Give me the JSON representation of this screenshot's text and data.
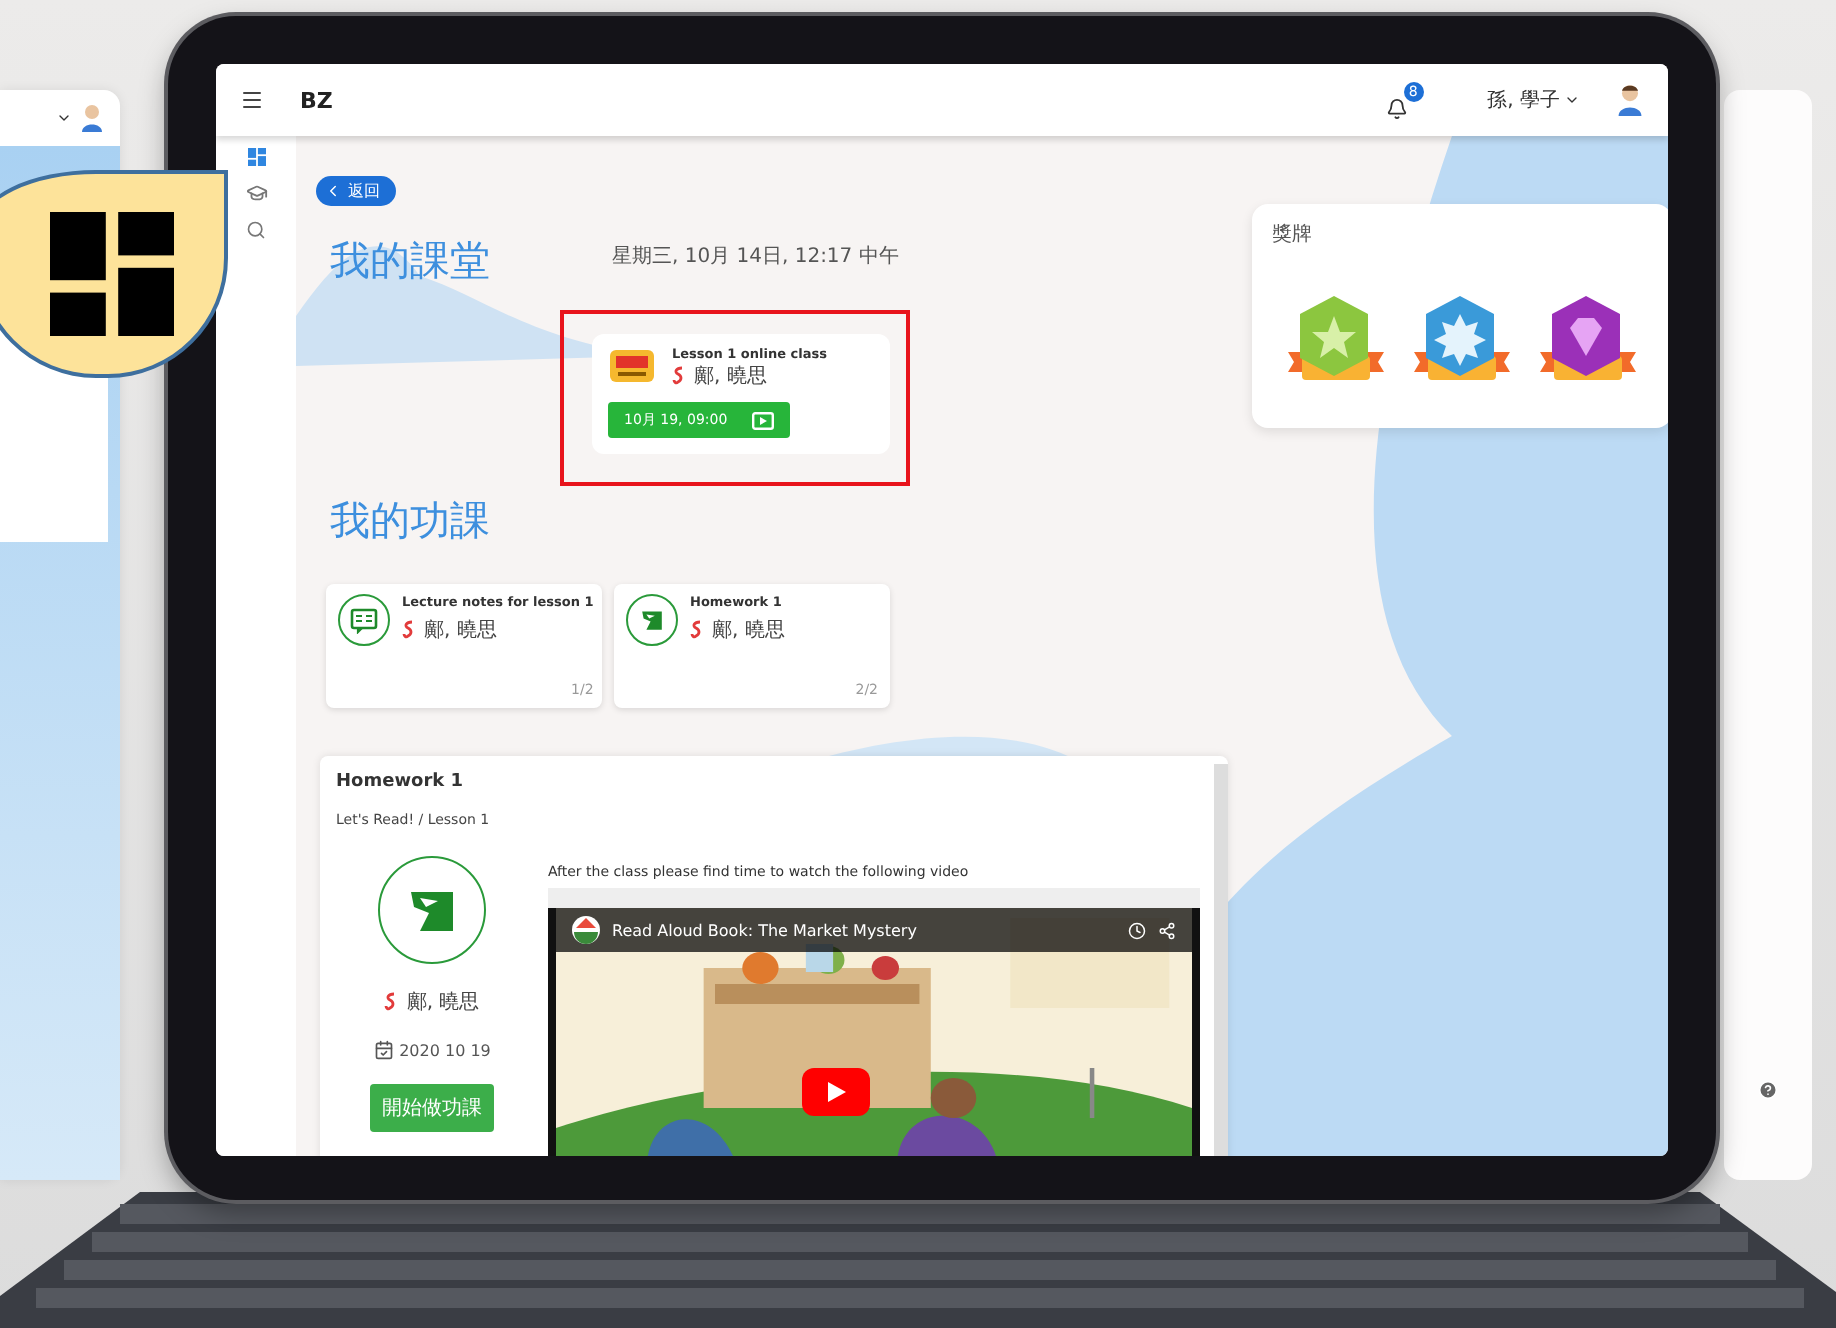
{
  "header": {
    "logo": "BZ",
    "notification_count": "8",
    "user_name": "孫, 學子"
  },
  "rail": [
    {
      "kind": "dashboard",
      "selected": true
    },
    {
      "kind": "courses",
      "selected": false
    },
    {
      "kind": "search",
      "selected": false
    }
  ],
  "back_button": "返回",
  "classes": {
    "title": "我的課堂",
    "date": "星期三, 10月 14日, 12:17 中午",
    "highlighted": true,
    "card": {
      "title": "Lesson 1 online class",
      "teacher": "鄺, 曉思",
      "time": "10月 19, 09:00"
    }
  },
  "homework": {
    "title": "我的功課",
    "cards": [
      {
        "kind": "notes",
        "title": "Lecture notes for lesson 1",
        "teacher": "鄺, 曉思",
        "count": "1/2"
      },
      {
        "kind": "homework",
        "title": "Homework 1",
        "teacher": "鄺, 曉思",
        "count": "2/2"
      }
    ]
  },
  "detail": {
    "title": "Homework 1",
    "breadcrumb": "Let's Read! / Lesson 1",
    "teacher": "鄺, 曉思",
    "date": "2020 10 19",
    "button": "開始做功課",
    "instructions": "After the class please find time to watch the following video",
    "video_title": "Read Aloud Book: The Market Mystery"
  },
  "medals": {
    "title": "獎牌",
    "items": [
      {
        "kind": "star",
        "color": "#8cc63f"
      },
      {
        "kind": "burst",
        "color": "#3a9ad9"
      },
      {
        "kind": "gem",
        "color": "#9b30b8"
      }
    ]
  }
}
